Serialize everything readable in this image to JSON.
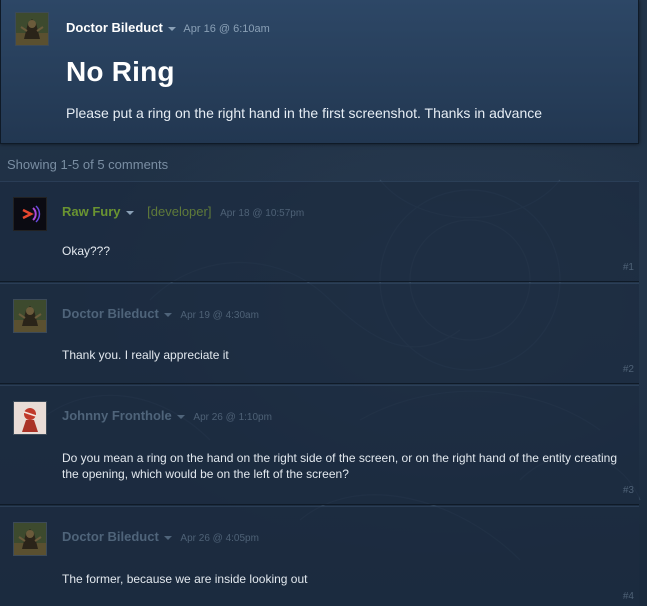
{
  "post": {
    "author": "Doctor Bileduct",
    "date": "Apr 16 @ 6:10am",
    "title": "No Ring",
    "body": "Please put a ring on the right hand in the first screenshot. Thanks in advance"
  },
  "comments_header": "Showing 1-5 of 5 comments",
  "comments": [
    {
      "author": "Raw Fury",
      "tag": "[developer]",
      "date": "Apr 18 @ 10:57pm",
      "text": "Okay???",
      "number": "#1",
      "author_color": "#6a9431",
      "avatar_icon": "raw-fury-logo-icon"
    },
    {
      "author": "Doctor Bileduct",
      "date": "Apr 19 @ 4:30am",
      "text": "Thank you. I really appreciate it",
      "number": "#2",
      "author_color": "#4f647a",
      "avatar_icon": "creature-avatar-icon"
    },
    {
      "author": "Johnny Fronthole",
      "date": "Apr 26 @ 1:10pm",
      "text": "Do you mean a ring on the hand on the right side of the screen, or on the right hand of the entity creating the opening, which would be on the left of the screen?",
      "number": "#3",
      "author_color": "#4f647a",
      "avatar_icon": "character-avatar-icon"
    },
    {
      "author": "Doctor Bileduct",
      "date": "Apr 26 @ 4:05pm",
      "text": "The former, because we are inside looking out",
      "number": "#4",
      "author_color": "#4f647a",
      "avatar_icon": "creature-avatar-icon"
    }
  ]
}
